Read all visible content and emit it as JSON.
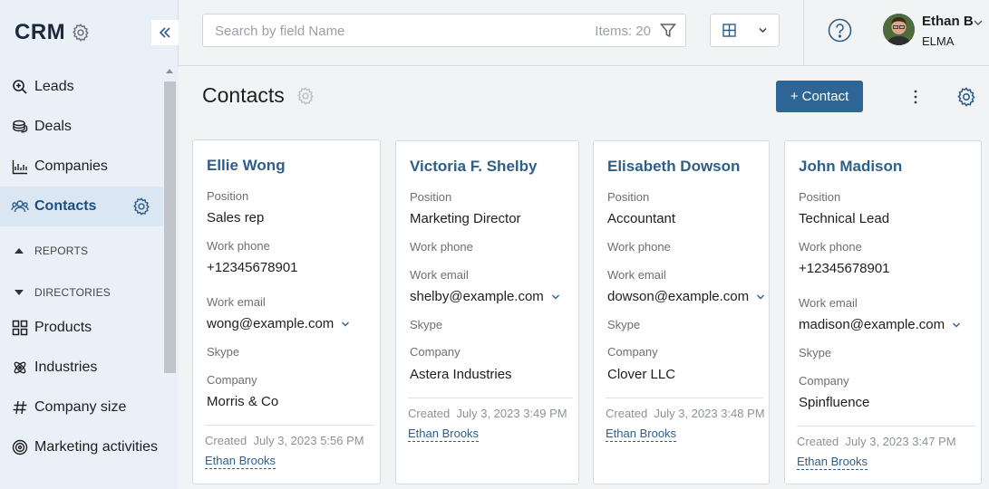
{
  "app": {
    "logo": "CRM"
  },
  "sidebar": {
    "items": [
      {
        "label": "Leads",
        "icon": "search-zoom-icon"
      },
      {
        "label": "Deals",
        "icon": "coins-icon"
      },
      {
        "label": "Companies",
        "icon": "chart-icon"
      },
      {
        "label": "Contacts",
        "icon": "people-icon"
      },
      {
        "label": "Products",
        "icon": "grid-icon"
      },
      {
        "label": "Industries",
        "icon": "atom-icon"
      },
      {
        "label": "Company size",
        "icon": "hash-icon"
      },
      {
        "label": "Marketing activities",
        "icon": "target-icon"
      }
    ],
    "sections": {
      "reports": "REPORTS",
      "directories": "DIRECTORIES"
    }
  },
  "topbar": {
    "search_placeholder": "Search by field Name",
    "items_count": "Items: 20",
    "user_name": "Ethan B",
    "user_org": "ELMA"
  },
  "page": {
    "title": "Contacts",
    "add_button": "+ Contact"
  },
  "labels": {
    "position": "Position",
    "work_phone": "Work phone",
    "work_email": "Work email",
    "skype": "Skype",
    "company": "Company",
    "created": "Created"
  },
  "cards": [
    {
      "name": "Ellie Wong",
      "position": "Sales rep",
      "work_phone": "+12345678901",
      "work_email": "wong@example.com",
      "company": "Morris & Co",
      "created_at": "July 3, 2023 5:56 PM",
      "author": "Ethan Brooks"
    },
    {
      "name": "Victoria F. Shelby",
      "position": "Marketing Director",
      "work_phone": "",
      "work_email": "shelby@example.com",
      "company": "Astera Industries",
      "created_at": "July 3, 2023 3:49 PM",
      "author": "Ethan Brooks"
    },
    {
      "name": "Elisabeth Dowson",
      "position": "Accountant",
      "work_phone": "",
      "work_email": "dowson@example.com",
      "company": "Clover LLC",
      "created_at": "July 3, 2023 3:48 PM",
      "author": "Ethan Brooks"
    },
    {
      "name": "John Madison",
      "position": "Technical Lead",
      "work_phone": "+12345678901",
      "work_email": "madison@example.com",
      "company": "Spinfluence",
      "created_at": "July 3, 2023 3:47 PM",
      "author": "Ethan Brooks"
    }
  ],
  "colors": {
    "accent": "#2d6596",
    "link": "#2d5f8a",
    "sidebar_bg": "#eaf0f8"
  }
}
